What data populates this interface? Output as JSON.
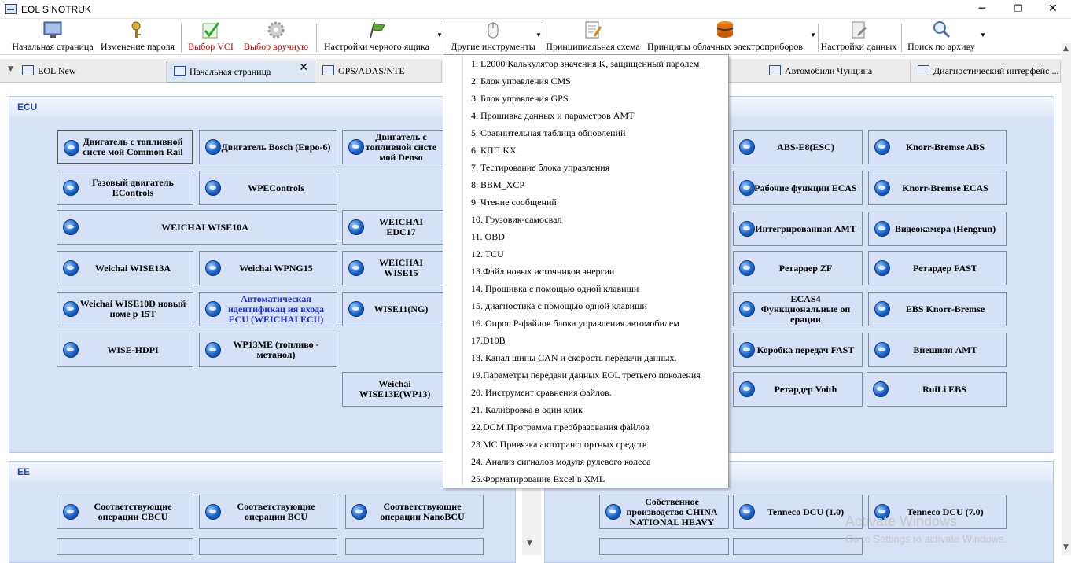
{
  "window": {
    "title": "EOL SINOTRUK",
    "minimize": "─",
    "maximize": "❐",
    "close": "✕"
  },
  "toolbar": {
    "home": "Начальная страница",
    "change_password": "Изменение пароля",
    "select_vci": "Выбор VCI",
    "select_manual": "Выбор вручную",
    "blackbox_settings": "Настройки черного ящика",
    "other_tools": "Другие инструменты",
    "schematic": "Принципиальная схема",
    "cloud_principles": "Принципы облачных электроприборов",
    "data_settings": "Настройки данных",
    "archive_search": "Поиск по архиву"
  },
  "tabs": [
    {
      "label": "EOL New"
    },
    {
      "label": "Начальная страница",
      "close": "✕"
    },
    {
      "label": "GPS/ADAS/NTE"
    },
    {
      "label": "Автомобили Чунцина"
    },
    {
      "label": "Диагностический интерфейс ..."
    }
  ],
  "ecu": {
    "title": "ECU",
    "left_buttons": [
      "Двигатель с топливной систе мой Common Rail",
      "Двигатель Bosch (Евро-6)",
      "Двигатель с топливной систе мой Denso",
      "Газовый двигатель EControls",
      "WPEControls",
      "WEICHAI WISE10A",
      "WEICHAI EDC17",
      "Weichai WISE13A",
      "Weichai WPNG15",
      "WEICHAI WISE15",
      "Weichai WISE10D новый номе р 15T",
      "Автоматическая идентификац ия входа ECU (WEICHAI ECU)",
      "WISE11(NG)",
      "WISE-HDPI",
      "WP13ME (топливо - метанол)",
      "Weichai WISE13E(WP13)"
    ],
    "right_buttons": [
      "ABS-E8(ESC)",
      "Knorr-Bremse ABS",
      "Рабочие функции ECAS",
      "Knorr-Bremse ECAS",
      "Интегрированная AMT",
      "Видеокамера (Hengrun)",
      "Ретардер ZF",
      "Ретардер FAST",
      "ECAS4 Функциональные оп ерации",
      "EBS Knorr-Bremse",
      "Коробка передач FAST",
      "Внешняя AMT",
      "Ретардер Voith",
      "RuiLi EBS"
    ]
  },
  "ee": {
    "title": "EE",
    "left_buttons": [
      "Соответствующие операции CBCU",
      "Соответствующие операции BCU",
      "Соответствующие операции NanoBCU"
    ],
    "right_buttons": [
      "Собственное производство CHINA NATIONAL HEAVY",
      "Tenneco DCU (1.0)",
      "Tenneco DCU (7.0)"
    ]
  },
  "menu_items": [
    "1. L2000 Калькулятор значения K, защищенный паролем",
    "2. Блок управления CMS",
    "3. Блок управления GPS",
    "4. Прошивка данных и параметров AMT",
    "5. Сравнительная таблица обновлений",
    "6. КПП KX",
    "7. Тестирование блока управления",
    "8. BBM_XCP",
    "9. Чтение сообщений",
    "10. Грузовик-самосвал",
    "11. OBD",
    "12. TCU",
    "13.Файл новых источников энергии",
    "14. Прошивка с помощью одной клавиши",
    "15. диагностика с помощью одной клавиши",
    "16. Опрос P-файлов блока управления автомобилем",
    "17.D10B",
    "18. Канал шины CAN и скорость передачи данных.",
    "19.Параметры передачи данных EOL третьего поколения",
    "20. Инструмент сравнения файлов.",
    "21. Калибровка в один клик",
    "22.DCM Программа преобразования файлов",
    "23.MC Привязка автотранспортных средств",
    "24. Анализ сигналов модуля рулевого колеса",
    "25.Форматирование Excel в XML"
  ],
  "watermark": {
    "line1": "Activate Windows",
    "line2": "Go to Settings to activate Windows."
  }
}
